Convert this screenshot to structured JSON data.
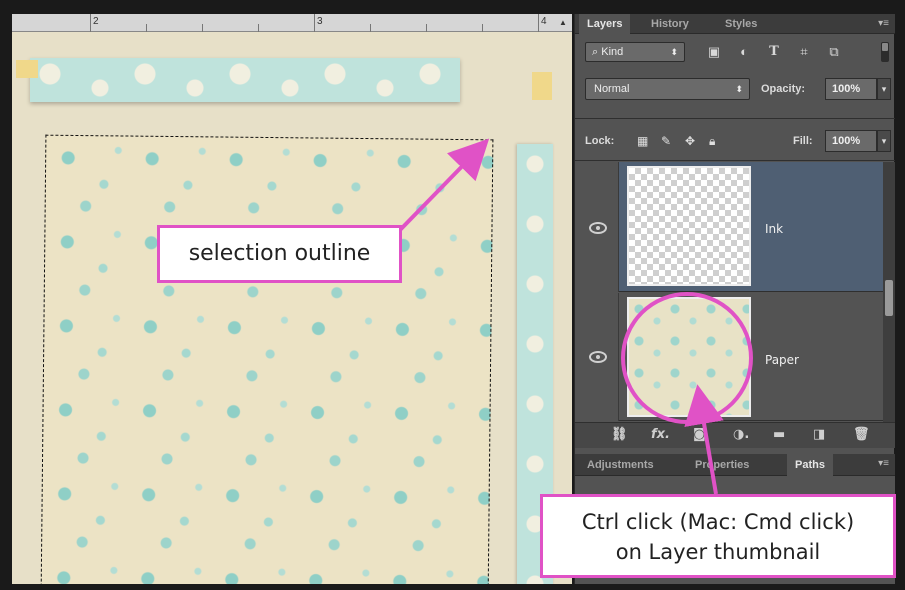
{
  "ruler": {
    "labels": [
      "2",
      "3",
      "4"
    ]
  },
  "layers_panel": {
    "tabs": [
      "Layers",
      "History",
      "Styles"
    ],
    "filter": {
      "kind_label": "Kind",
      "search_glyph": "⌕"
    },
    "blend_mode": "Normal",
    "opacity_label": "Opacity:",
    "opacity_value": "100%",
    "lock_label": "Lock:",
    "fill_label": "Fill:",
    "fill_value": "100%",
    "layers": [
      {
        "name": "Ink",
        "selected": true,
        "visible": true,
        "thumbnail": "transparent"
      },
      {
        "name": "Paper",
        "selected": false,
        "visible": true,
        "thumbnail": "floral-paper"
      }
    ],
    "footer_icons": [
      "link-icon",
      "fx-icon",
      "mask-icon",
      "adjustment-icon",
      "folder-icon",
      "new-layer-icon",
      "trash-icon"
    ]
  },
  "lower_panel": {
    "tabs": [
      "Adjustments",
      "Properties",
      "Paths"
    ]
  },
  "annotations": {
    "selection_callout": "selection outline",
    "ctrl_callout_line1": "Ctrl click (Mac: Cmd click)",
    "ctrl_callout_line2": "on Layer thumbnail",
    "accent_color": "#e052c6"
  }
}
